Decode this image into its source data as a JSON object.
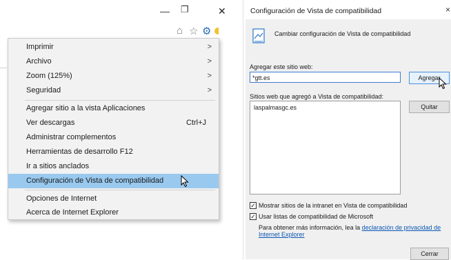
{
  "window": {
    "minimize_glyph": "—",
    "restore_glyph": "❐",
    "close_glyph": "✕",
    "home_icon": "⌂",
    "favorites_icon": "☆",
    "tools_icon": "⚙"
  },
  "menu": {
    "items": [
      {
        "label": "Imprimir",
        "arrow": ">"
      },
      {
        "label": "Archivo",
        "arrow": ">"
      },
      {
        "label": "Zoom (125%)",
        "arrow": ">"
      },
      {
        "label": "Seguridad",
        "arrow": ">"
      },
      {
        "label": "Agregar sitio a la vista Aplicaciones"
      },
      {
        "label": "Ver descargas",
        "shortcut": "Ctrl+J"
      },
      {
        "label": "Administrar complementos"
      },
      {
        "label": "Herramientas de desarrollo F12"
      },
      {
        "label": "Ir a sitios anclados"
      },
      {
        "label": "Configuración de Vista de compatibilidad"
      },
      {
        "label": "Opciones de Internet"
      },
      {
        "label": "Acerca de Internet Explorer"
      }
    ]
  },
  "dialog": {
    "title": "Configuración de Vista de compatibilidad",
    "close_glyph": "×",
    "header_text": "Cambiar configuración de Vista de compatibilidad",
    "add_label": "Agregar este sitio web:",
    "add_value": "*gtt.es",
    "add_button": "Agregar",
    "list_label": "Sitios web que agregó a Vista de compatibilidad:",
    "list_items": [
      "laspalmasgc.es"
    ],
    "remove_button": "Quitar",
    "check_intranet": "Mostrar sitios de la intranet en Vista de compatibilidad",
    "check_microsoft": "Usar listas de compatibilidad de Microsoft",
    "info_text": "Para obtener más información, lea la",
    "info_link": "declaración de privacidad de Internet Explorer",
    "close_button": "Cerrar"
  }
}
